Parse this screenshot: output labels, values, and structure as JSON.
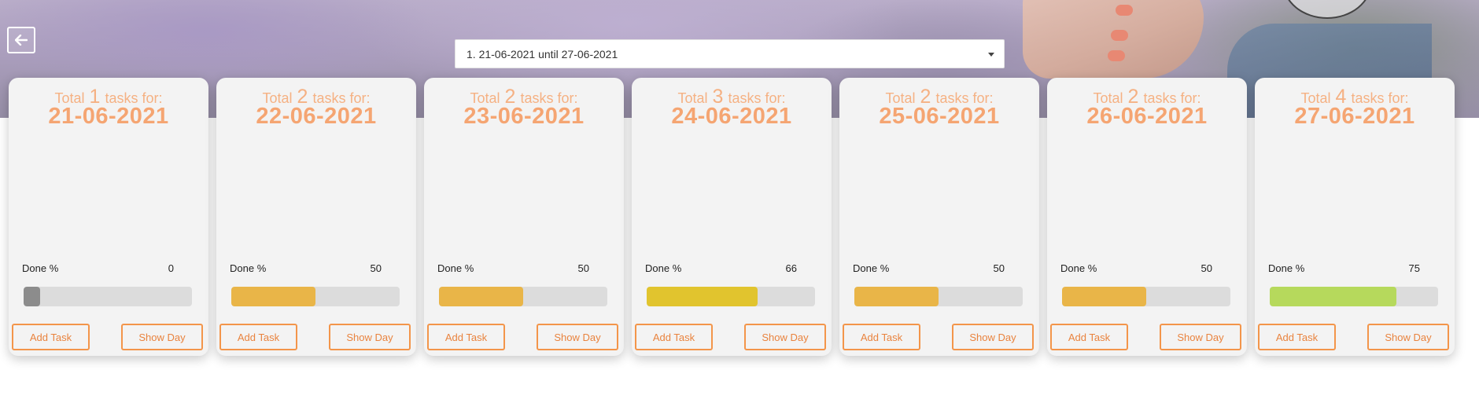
{
  "header": {
    "back_button": "back-arrow-icon",
    "week_selector": {
      "value": "1. 21-06-2021 until 27-06-2021"
    }
  },
  "labels": {
    "total": "Total",
    "tasks_for": "tasks for:",
    "done_percent": "Done %",
    "add_task": "Add Task",
    "show_day": "Show Day"
  },
  "days": [
    {
      "date": "21-06-2021",
      "total": "1",
      "done_percent": 0,
      "bar_color": "#8c8c8c"
    },
    {
      "date": "22-06-2021",
      "total": "2",
      "done_percent": 50,
      "bar_color": "#e9b548"
    },
    {
      "date": "23-06-2021",
      "total": "2",
      "done_percent": 50,
      "bar_color": "#e9b548"
    },
    {
      "date": "24-06-2021",
      "total": "3",
      "done_percent": 66,
      "bar_color": "#e1c42e"
    },
    {
      "date": "25-06-2021",
      "total": "2",
      "done_percent": 50,
      "bar_color": "#e9b548"
    },
    {
      "date": "26-06-2021",
      "total": "2",
      "done_percent": 50,
      "bar_color": "#e9b548"
    },
    {
      "date": "27-06-2021",
      "total": "4",
      "done_percent": 75,
      "bar_color": "#b6d95c"
    }
  ],
  "colors": {
    "accent": "#f3954a",
    "title": "#f5b183",
    "card_background": "#f3f3f3"
  }
}
